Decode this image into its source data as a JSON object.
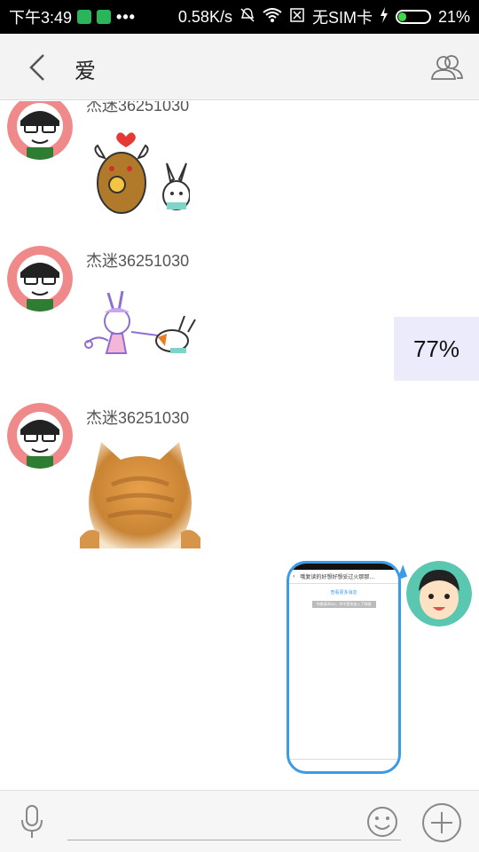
{
  "status_bar": {
    "time": "下午3:49",
    "network_speed": "0.58K/s",
    "sim": "无SIM卡",
    "battery": "21%"
  },
  "header": {
    "title": "爱"
  },
  "messages": [
    {
      "sender": "杰迷36251030",
      "type": "sticker",
      "sticker": "bull-heart-sticker"
    },
    {
      "sender": "杰迷36251030",
      "type": "sticker",
      "sticker": "rabbit-fight-sticker"
    },
    {
      "sender": "杰迷36251030",
      "type": "sticker",
      "sticker": "cat-sticker"
    }
  ],
  "upload_progress": "77%",
  "sent_screenshot": {
    "title": "哦复读的好想好想妥过火那那...",
    "link": "查看更多消息",
    "note": "你邀请36xx，并不是你加入了群聊"
  },
  "input": {
    "placeholder": ""
  },
  "colors": {
    "accent": "#3a9be8",
    "avatar_ring": "#f08a8a",
    "progress_bg": "#ebebfb"
  }
}
